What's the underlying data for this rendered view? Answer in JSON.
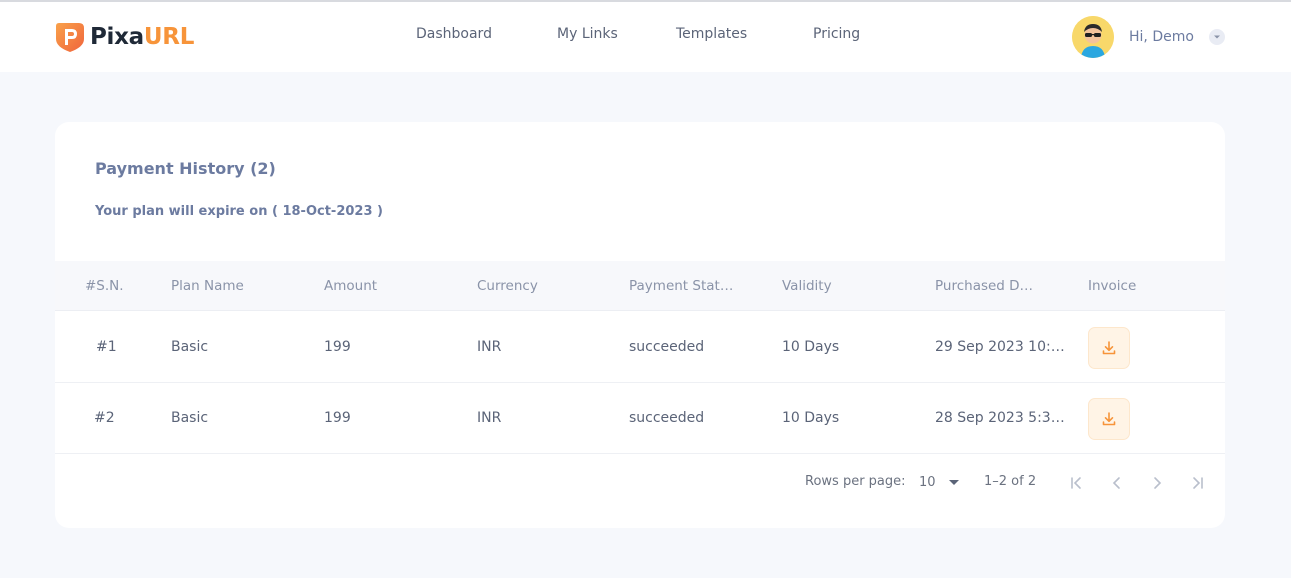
{
  "brand": {
    "name_part1": "Pixa",
    "name_part2": "URL",
    "accent": "#f7943a"
  },
  "nav": {
    "items": [
      {
        "label": "Dashboard"
      },
      {
        "label": "My Links"
      },
      {
        "label": "Templates"
      },
      {
        "label": "Pricing"
      }
    ]
  },
  "user": {
    "greeting": "Hi, Demo",
    "avatar_icon": "user-avatar"
  },
  "payment": {
    "title": "Payment History (2)",
    "subtitle": "Your plan will expire on ( 18-Oct-2023 )",
    "columns": [
      "#S.N.",
      "Plan Name",
      "Amount",
      "Currency",
      "Payment Stat…",
      "Validity",
      "Purchased D…",
      "Invoice"
    ],
    "rows": [
      {
        "sn": "#1",
        "plan": "Basic",
        "amount": "199",
        "currency": "INR",
        "status": "succeeded",
        "validity": "10 Days",
        "purchased": "29 Sep 2023 10:…",
        "invoice_icon": "download-icon"
      },
      {
        "sn": "#2",
        "plan": "Basic",
        "amount": "199",
        "currency": "INR",
        "status": "succeeded",
        "validity": "10 Days",
        "purchased": "28 Sep 2023 5:3…",
        "invoice_icon": "download-icon"
      }
    ]
  },
  "pagination": {
    "rows_per_page_label": "Rows per page:",
    "rows_per_page_value": "10",
    "range_text": "1–2 of 2"
  }
}
